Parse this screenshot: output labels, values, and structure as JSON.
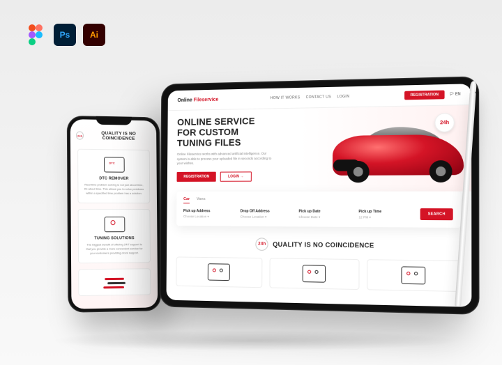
{
  "app_icons": {
    "figma": "Figma",
    "ps": "Ps",
    "ai": "Ai"
  },
  "tablet": {
    "brand_a": "Online",
    "brand_b": "Fileservice",
    "nav": {
      "how": "HOW IT WORKS",
      "contact": "CONTACT US",
      "login": "LOGIN"
    },
    "register": "REGISTRATION",
    "lang": "EN",
    "hero": {
      "title_l1": "ONLINE SERVICE",
      "title_l2": "FOR CUSTOM",
      "title_l3": "TUNING FILES",
      "desc": "Online Fileservice works with advanced artificial intelligence. Our system is able to process your uploaded file in seconds according to your wishes.",
      "btn_primary": "REGISTRATION",
      "btn_secondary": "LOGIN →",
      "badge": "24h"
    },
    "search": {
      "tab_active": "Car",
      "tab_inactive": "Vans",
      "f1_label": "Pick up Address",
      "f1_value": "Choose Location ▾",
      "f2_label": "Drop Off Address",
      "f2_value": "Choose Location ▾",
      "f3_label": "Pick up Date",
      "f3_value": "Choose Date ▾",
      "f4_label": "Pick up Time",
      "f4_value": "12 PM ▾",
      "button": "SEARCH"
    },
    "quality_badge": "24h",
    "quality_title": "QUALITY IS NO COINCIDENCE"
  },
  "phone": {
    "quality_badge": "24h",
    "quality_title": "QUALITY IS NO COINCIDENCE",
    "card1": {
      "icon_label": "DTC",
      "title": "DTC REMOVER",
      "desc": "Real-time problem solving is not just about time, it's about time. This allows you to solve problems within a specified time problem has a solution."
    },
    "card2": {
      "title": "TUNING SOLUTIONS",
      "desc": "The biggest benefit of offering 24/7 support is that you provide a more convenient service for your customers providing clock support."
    }
  }
}
